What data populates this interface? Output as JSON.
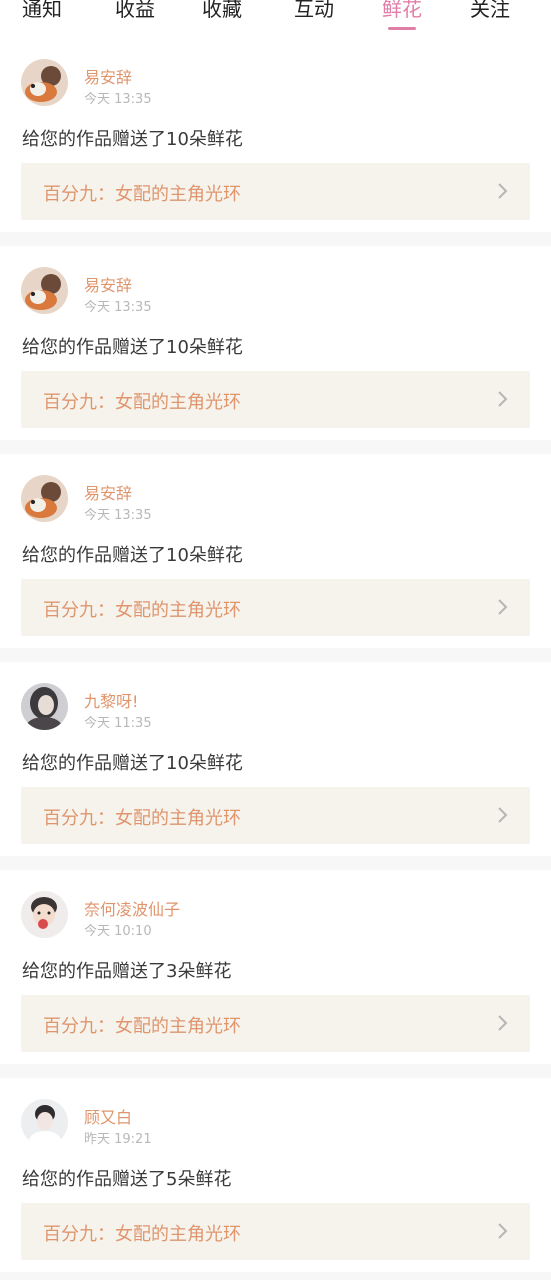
{
  "tabs": [
    {
      "label": "通知",
      "active": false
    },
    {
      "label": "收益",
      "active": false
    },
    {
      "label": "收藏",
      "active": false
    },
    {
      "label": "互动",
      "active": false
    },
    {
      "label": "鲜花",
      "active": true
    },
    {
      "label": "关注",
      "active": false
    }
  ],
  "accent_color": "#e07ea8",
  "name_color": "#e0956c",
  "feed": [
    {
      "name": "易安辞",
      "time": "今天 13:35",
      "message": "给您的作品赠送了10朵鲜花",
      "work_title": "百分九：女配的主角光环"
    },
    {
      "name": "易安辞",
      "time": "今天 13:35",
      "message": "给您的作品赠送了10朵鲜花",
      "work_title": "百分九：女配的主角光环"
    },
    {
      "name": "易安辞",
      "time": "今天 13:35",
      "message": "给您的作品赠送了10朵鲜花",
      "work_title": "百分九：女配的主角光环"
    },
    {
      "name": "九黎呀!",
      "time": "今天 11:35",
      "message": "给您的作品赠送了10朵鲜花",
      "work_title": "百分九：女配的主角光环"
    },
    {
      "name": "奈何凌波仙子",
      "time": "今天 10:10",
      "message": "给您的作品赠送了3朵鲜花",
      "work_title": "百分九：女配的主角光环"
    },
    {
      "name": "顾又白",
      "time": "昨天 19:21",
      "message": "给您的作品赠送了5朵鲜花",
      "work_title": "百分九：女配的主角光环"
    }
  ],
  "icons": {
    "avatar": "avatar",
    "chevron": "chevron-right-icon"
  }
}
